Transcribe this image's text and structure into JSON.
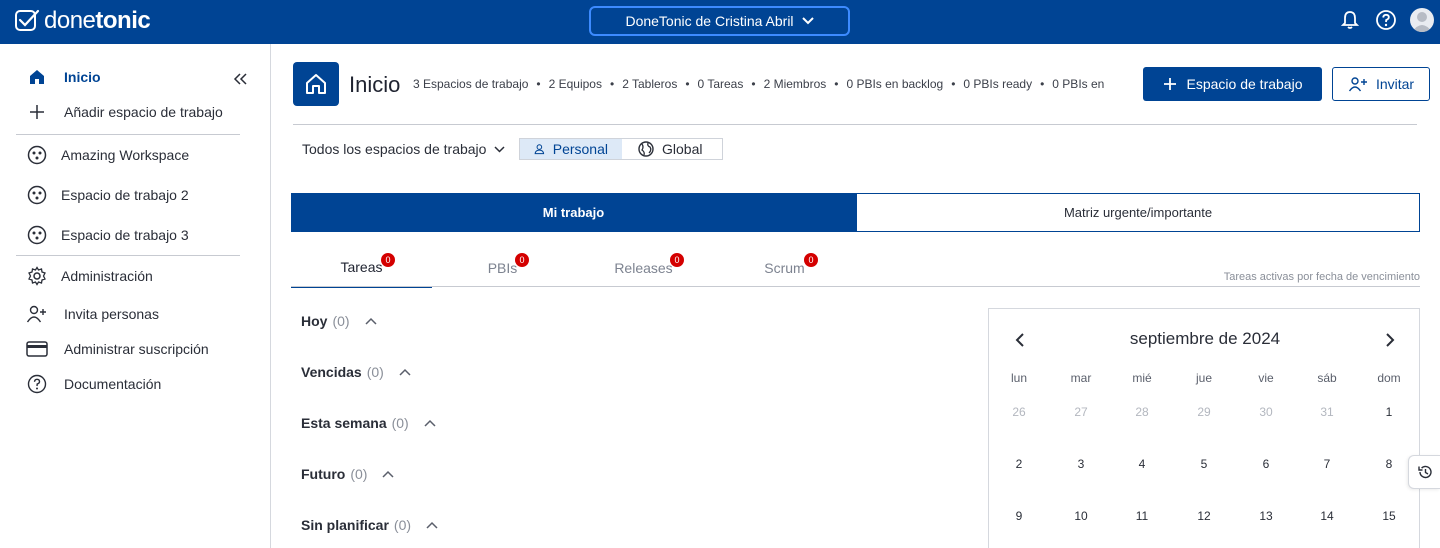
{
  "app": {
    "logo_light": "done",
    "logo_bold": "tonic",
    "workspace_selector": "DoneTonic de Cristina Abril"
  },
  "sidebar": {
    "items": [
      {
        "label": "Inicio",
        "icon": "home-icon",
        "active": true
      },
      {
        "label": "Añadir espacio de trabajo",
        "icon": "plus-icon"
      },
      {
        "label": "Amazing Workspace",
        "icon": "workspace-icon"
      },
      {
        "label": "Espacio de trabajo 2",
        "icon": "workspace-icon"
      },
      {
        "label": "Espacio de trabajo 3",
        "icon": "workspace-icon"
      },
      {
        "label": "Administración",
        "icon": "gear-icon"
      },
      {
        "label": "Invita personas",
        "icon": "add-person-icon"
      },
      {
        "label": "Administrar suscripción",
        "icon": "credit-card-icon"
      },
      {
        "label": "Documentación",
        "icon": "help-icon"
      }
    ]
  },
  "header": {
    "title": "Inicio",
    "stats": [
      "3 Espacios de trabajo",
      "2 Equipos",
      "2 Tableros",
      "0 Tareas",
      "2 Miembros",
      "0 PBIs en backlog",
      "0 PBIs ready",
      "0 PBIs en"
    ],
    "primary_button": "Espacio de trabajo",
    "invite_button": "Invitar"
  },
  "filters": {
    "scope": "Todos los espacios de trabajo",
    "segments": [
      "Personal",
      "Global"
    ],
    "selected_segment": "Personal"
  },
  "main_tabs": [
    "Mi trabajo",
    "Matriz urgente/importante"
  ],
  "sub_tabs": [
    {
      "label": "Tareas",
      "badge": "0"
    },
    {
      "label": "PBIs",
      "badge": "0"
    },
    {
      "label": "Releases",
      "badge": "0"
    },
    {
      "label": "Scrum",
      "badge": "0"
    }
  ],
  "sort_hint": "Tareas activas por fecha de vencimiento",
  "groups": [
    {
      "name": "Hoy",
      "count": "(0)"
    },
    {
      "name": "Vencidas",
      "count": "(0)"
    },
    {
      "name": "Esta semana",
      "count": "(0)"
    },
    {
      "name": "Futuro",
      "count": "(0)"
    },
    {
      "name": "Sin planificar",
      "count": "(0)"
    }
  ],
  "calendar": {
    "title": "septiembre de 2024",
    "weekdays": [
      "lun",
      "mar",
      "mié",
      "jue",
      "vie",
      "sáb",
      "dom"
    ],
    "weeks": [
      [
        "26",
        "27",
        "28",
        "29",
        "30",
        "31",
        "1"
      ],
      [
        "2",
        "3",
        "4",
        "5",
        "6",
        "7",
        "8"
      ],
      [
        "9",
        "10",
        "11",
        "12",
        "13",
        "14",
        "15"
      ]
    ],
    "muted_first_row_count": 6
  },
  "colors": {
    "brand": "#004494",
    "badge": "#d40000"
  }
}
